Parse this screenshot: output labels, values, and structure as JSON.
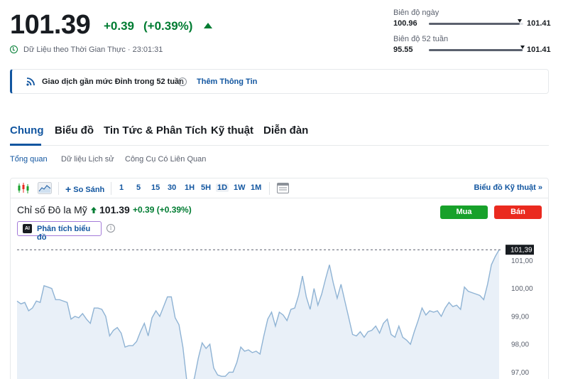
{
  "quote": {
    "price": "101.39",
    "change": "+0.39",
    "change_pct": "(+0.39%)",
    "realtime_label": "Dữ Liệu theo Thời Gian Thực · 23:01:31"
  },
  "ranges": {
    "day": {
      "label": "Biên độ ngày",
      "low": "100.96",
      "high": "101.41",
      "position": 0.96
    },
    "week52": {
      "label": "Biên độ 52 tuần",
      "low": "95.55",
      "high": "101.41",
      "position": 0.99
    }
  },
  "notice": {
    "text": "Giao dịch gần mức Đỉnh trong 52 tuần",
    "link": "Thêm Thông Tin"
  },
  "tabs": [
    "Chung",
    "Biểu đồ",
    "Tin Tức & Phân Tích",
    "Kỹ thuật",
    "Diễn đàn"
  ],
  "subtabs": [
    "Tổng quan",
    "Dữ liệu Lịch sử",
    "Công Cụ Có Liên Quan"
  ],
  "toolbar": {
    "compare": "So Sánh",
    "intervals": [
      "1",
      "5",
      "15",
      "30",
      "1H",
      "5H",
      "1D",
      "1W",
      "1M"
    ],
    "active_interval": "1D",
    "tech_chart": "Biểu đồ Kỹ thuật »"
  },
  "chart_header": {
    "title": "Chỉ số Đô la Mỹ",
    "price": "101.39",
    "change": "+0.39 (+0.39%)",
    "buy": "Mua",
    "sell": "Bán",
    "ai_label": "Phân tích biểu đồ",
    "ai_badge": "AI"
  },
  "colors": {
    "up": "#007c32",
    "accent": "#1256a0",
    "buy": "#17a12a",
    "sell": "#ea2a1f",
    "line": "#8fb3d4",
    "area": "#e9f0f8"
  },
  "chart_data": {
    "type": "area",
    "title": "",
    "xlabel": "",
    "ylabel": "",
    "ylim": [
      96.55,
      101.65
    ],
    "yticks": [
      "101,00",
      "100,00",
      "99,00",
      "98,00",
      "97,00"
    ],
    "last_value_label": "101,39",
    "grid": false,
    "values": [
      99.55,
      99.45,
      99.5,
      99.2,
      99.3,
      99.55,
      99.5,
      100.1,
      100.05,
      100.0,
      99.6,
      99.6,
      99.55,
      99.5,
      98.9,
      99.0,
      98.95,
      99.1,
      98.9,
      98.75,
      99.3,
      99.3,
      99.25,
      99.0,
      98.3,
      98.5,
      98.6,
      98.4,
      97.9,
      97.95,
      97.95,
      98.1,
      98.45,
      98.75,
      98.3,
      98.95,
      99.2,
      99.0,
      99.35,
      99.7,
      99.7,
      98.95,
      98.7,
      97.9,
      96.7,
      96.45,
      96.8,
      97.5,
      98.05,
      97.85,
      98.0,
      97.15,
      96.9,
      96.85,
      96.85,
      97.0,
      97.0,
      97.35,
      97.9,
      97.75,
      97.8,
      97.7,
      97.75,
      97.65,
      98.3,
      98.9,
      99.15,
      98.65,
      99.15,
      99.05,
      98.85,
      99.25,
      99.3,
      99.75,
      100.45,
      99.7,
      99.25,
      100.0,
      99.4,
      99.8,
      100.35,
      100.85,
      100.2,
      99.65,
      100.15,
      99.55,
      98.95,
      98.35,
      98.3,
      98.45,
      98.25,
      98.45,
      98.5,
      98.65,
      98.4,
      98.75,
      98.9,
      98.35,
      98.25,
      98.65,
      98.25,
      98.15,
      98.0,
      98.45,
      98.85,
      99.3,
      99.05,
      99.2,
      99.15,
      99.2,
      99.0,
      99.3,
      99.5,
      99.35,
      99.4,
      99.25,
      100.05,
      99.9,
      99.85,
      99.8,
      99.75,
      99.6,
      100.15,
      100.85,
      101.15,
      101.39
    ]
  }
}
